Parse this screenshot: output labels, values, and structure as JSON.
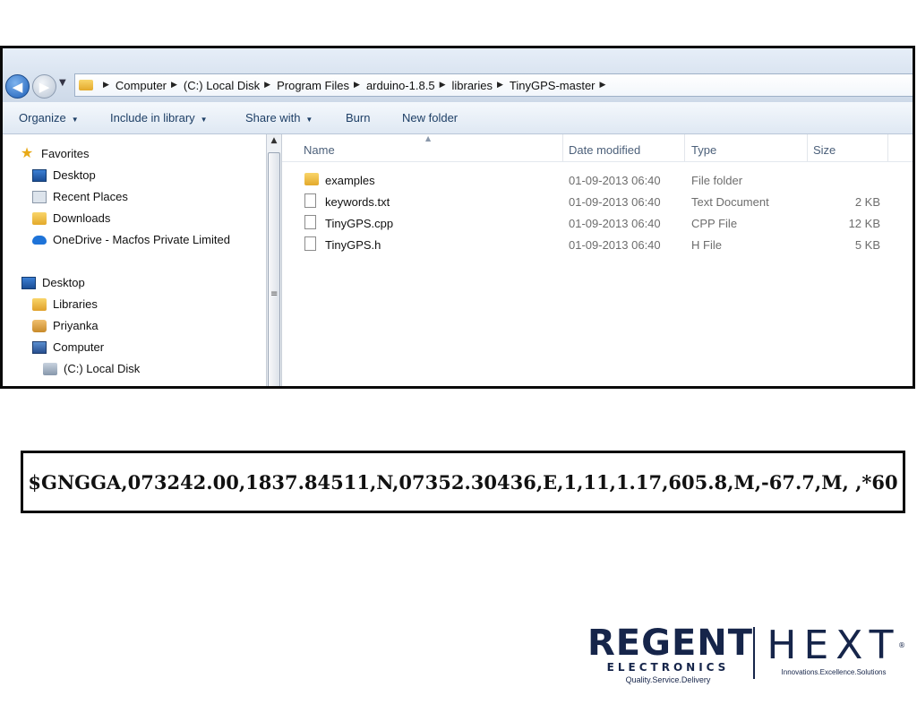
{
  "explorer": {
    "breadcrumbs": [
      "Computer",
      "(C:) Local Disk",
      "Program Files",
      "arduino-1.8.5",
      "libraries",
      "TinyGPS-master"
    ],
    "toolbar": {
      "organize": "Organize",
      "include_in_library": "Include in library",
      "share_with": "Share with",
      "burn": "Burn",
      "new_folder": "New folder"
    },
    "nav": {
      "favorites": "Favorites",
      "fav_items": [
        "Desktop",
        "Recent Places",
        "Downloads",
        "OneDrive - Macfos Private Limited"
      ],
      "desktop": "Desktop",
      "desktop_items": [
        "Libraries",
        "Priyanka",
        "Computer"
      ],
      "local_disk": "(C:) Local Disk"
    },
    "columns": {
      "name": "Name",
      "date": "Date modified",
      "type": "Type",
      "size": "Size"
    },
    "files": [
      {
        "name": "examples",
        "date": "01-09-2013 06:40",
        "type": "File folder",
        "size": "",
        "icon": "folder-icon"
      },
      {
        "name": "keywords.txt",
        "date": "01-09-2013 06:40",
        "type": "Text Document",
        "size": "2 KB",
        "icon": "document-icon"
      },
      {
        "name": "TinyGPS.cpp",
        "date": "01-09-2013 06:40",
        "type": "CPP File",
        "size": "12 KB",
        "icon": "document-icon"
      },
      {
        "name": "TinyGPS.h",
        "date": "01-09-2013 06:40",
        "type": "H File",
        "size": "5 KB",
        "icon": "document-icon"
      }
    ]
  },
  "nmea": {
    "sentence": "$GNGGA,073242.00,1837.84511,N,07352.30436,E,1,11,1.17,605.8,M,-67.7,M, ,*60"
  },
  "logos": {
    "regent_word": "REGENT",
    "regent_sub": "ELECTRONICS",
    "regent_tagline": "Quality.Service.Delivery",
    "hext_word": "HEXT",
    "hext_tagline": "Innovations.Excellence.Solutions",
    "hext_reg_mark": "®"
  },
  "colors": {
    "brand_navy": "#16254a",
    "toolbar_text": "#1e3f66",
    "header_text": "#4c607a"
  }
}
